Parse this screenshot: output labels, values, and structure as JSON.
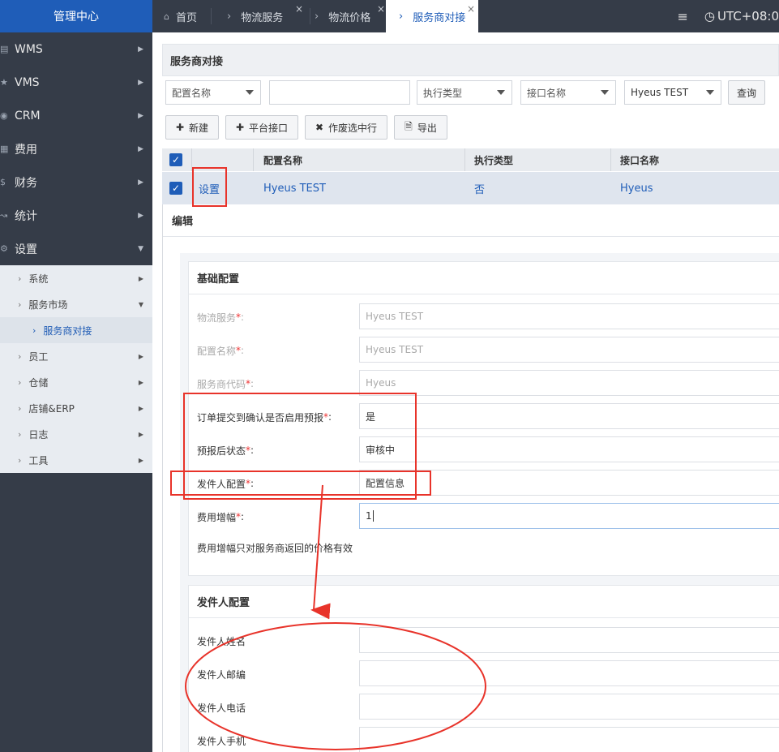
{
  "sidebar": {
    "header": "管理中心",
    "top_items": [
      {
        "label": "WMS",
        "icon": "bank-icon"
      },
      {
        "label": "VMS",
        "icon": "star-icon"
      },
      {
        "label": "CRM",
        "icon": "user-icon"
      },
      {
        "label": "费用",
        "icon": "grid-icon"
      },
      {
        "label": "财务",
        "icon": "dollar-icon"
      },
      {
        "label": "统计",
        "icon": "chart-icon"
      },
      {
        "label": "设置",
        "icon": "gear-icon"
      }
    ],
    "sub_items": [
      {
        "label": "系统"
      },
      {
        "label": "服务市场"
      },
      {
        "label": "服务商对接"
      },
      {
        "label": "员工"
      },
      {
        "label": "仓储"
      },
      {
        "label": "店铺&ERP"
      },
      {
        "label": "日志"
      },
      {
        "label": "工具"
      }
    ]
  },
  "topbar": {
    "tabs": [
      {
        "label": "首页"
      },
      {
        "label": "物流服务"
      },
      {
        "label": "物流价格"
      },
      {
        "label": "服务商对接"
      }
    ],
    "timezone": "UTC+08:0"
  },
  "main": {
    "title": "服务商对接",
    "filters": {
      "config_name_select": "配置名称",
      "config_name_input": "",
      "exec_type": "执行类型",
      "interface_name": "接口名称",
      "service": "Hyeus TEST",
      "query": "查询"
    },
    "actions": {
      "new": "新建",
      "platform": "平台接口",
      "void": "作废选中行",
      "export": "导出"
    },
    "table": {
      "headers": [
        "配置名称",
        "执行类型",
        "接口名称"
      ],
      "rows": [
        {
          "action": "设置",
          "name": "Hyeus TEST",
          "exec": "否",
          "interface": "Hyeus"
        }
      ]
    }
  },
  "modal": {
    "title": "编辑",
    "basic": {
      "title": "基础配置",
      "fields": [
        {
          "label": "物流服务",
          "value": "Hyeus TEST"
        },
        {
          "label": "配置名称",
          "value": "Hyeus TEST"
        },
        {
          "label": "服务商代码",
          "value": "Hyeus"
        },
        {
          "label": "订单提交到确认是否启用预报",
          "value": "是"
        },
        {
          "label": "预报后状态",
          "value": "审核中"
        },
        {
          "label": "发件人配置",
          "value": "配置信息"
        },
        {
          "label": "费用增幅",
          "value": "1"
        }
      ],
      "note": "费用增幅只对服务商返回的价格有效"
    },
    "sender": {
      "title": "发件人配置",
      "fields": [
        {
          "label": "发件人姓名",
          "value": ""
        },
        {
          "label": "发件人邮编",
          "value": ""
        },
        {
          "label": "发件人电话",
          "value": ""
        },
        {
          "label": "发件人手机",
          "value": ""
        }
      ]
    }
  },
  "colors": {
    "accent": "#1f5db8",
    "sidebar_bg": "#353c48",
    "annotation": "#e8332a",
    "required": "#e33333"
  }
}
